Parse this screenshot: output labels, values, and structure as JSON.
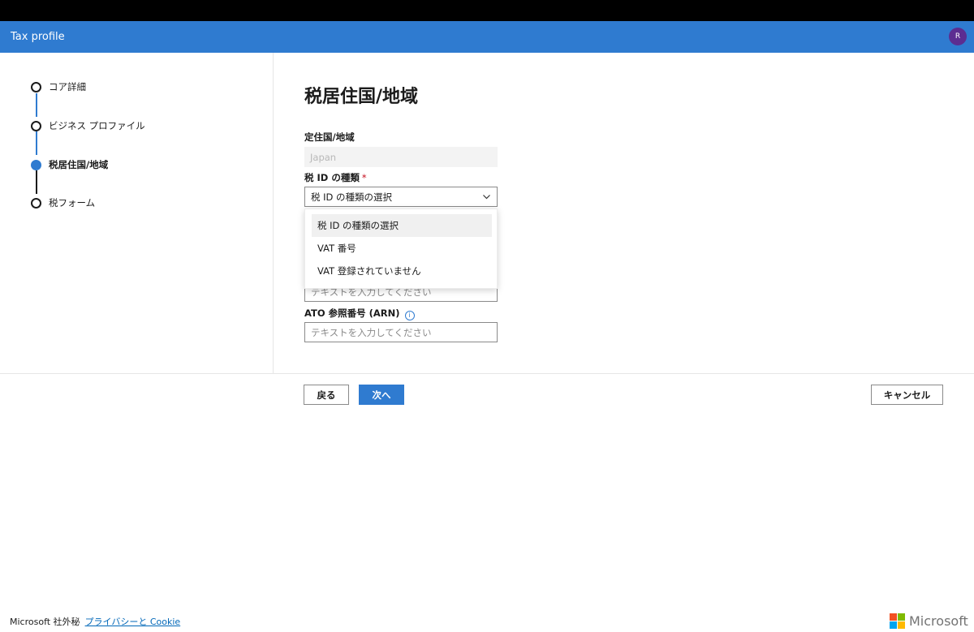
{
  "header": {
    "title": "Tax profile",
    "avatar_initial": "R"
  },
  "steps": [
    {
      "label": "コア詳細",
      "active": false
    },
    {
      "label": "ビジネス プロファイル",
      "active": false
    },
    {
      "label": "税居住国/地域",
      "active": true
    },
    {
      "label": "税フォーム",
      "active": false
    }
  ],
  "main": {
    "title": "税居住国/地域",
    "residence": {
      "label": "定住国/地域",
      "value": "Japan"
    },
    "tax_id_type": {
      "label": "税 ID の種類",
      "required_mark": "*",
      "selected": "税 ID の種類の選択",
      "options": [
        "税 ID の種類の選択",
        "VAT 番号",
        "VAT 登録されていません"
      ]
    },
    "hidden_field": {
      "placeholder": "テキストを入力してください"
    },
    "arn": {
      "label": "ATO 参照番号 (ARN)",
      "info_icon": "i",
      "placeholder": "テキストを入力してください"
    }
  },
  "buttons": {
    "back": "戻る",
    "next": "次へ",
    "cancel": "キャンセル"
  },
  "footer": {
    "confidential": "Microsoft 社外秘",
    "privacy_link": "プライバシーと Cookie",
    "logo_text": "Microsoft"
  },
  "colors": {
    "header": "#2f7bd0",
    "accent": "#2f7bd0",
    "avatar": "#5c2d91",
    "logo_red": "#f25022",
    "logo_green": "#7fba00",
    "logo_blue": "#00a4ef",
    "logo_yellow": "#ffb900"
  }
}
